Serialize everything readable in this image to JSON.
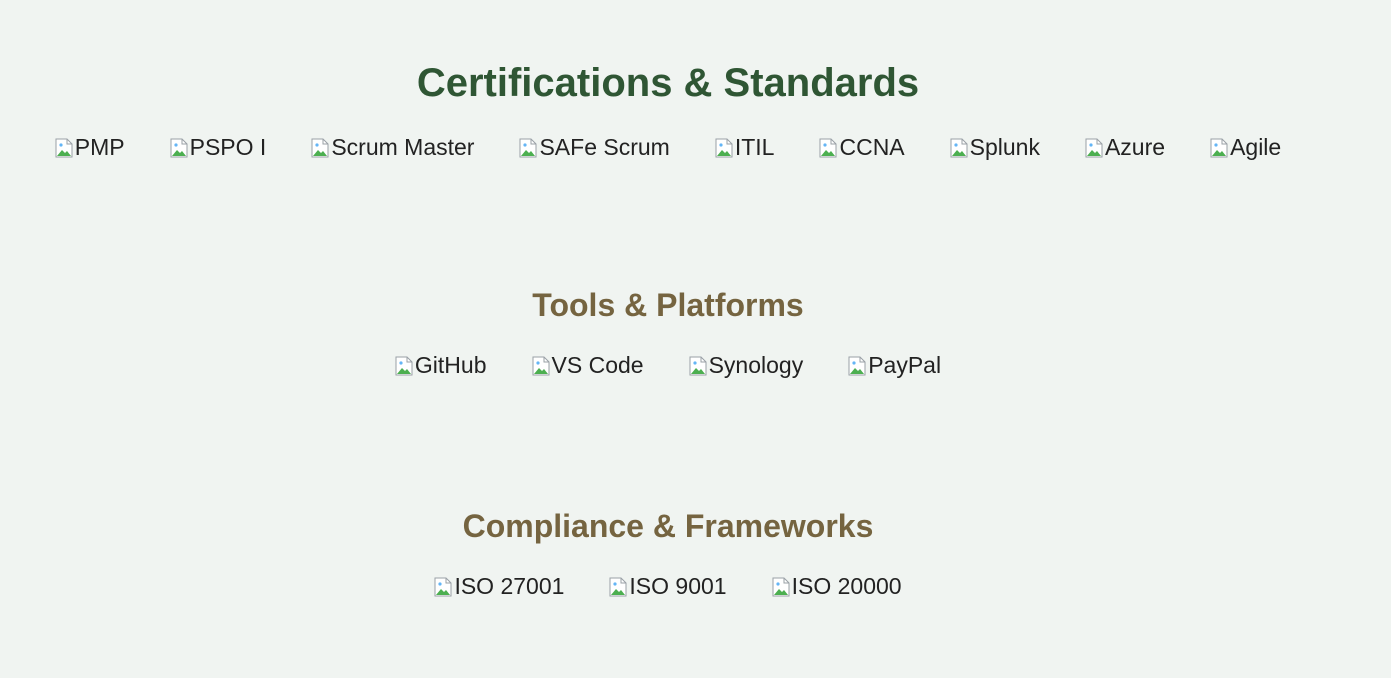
{
  "sections": [
    {
      "title": "Certifications & Standards",
      "items": [
        "PMP",
        "PSPO I",
        "Scrum Master",
        "SAFe Scrum",
        "ITIL",
        "CCNA",
        "Splunk",
        "Azure",
        "Agile"
      ]
    },
    {
      "title": "Tools & Platforms",
      "items": [
        "GitHub",
        "VS Code",
        "Synology",
        "PayPal"
      ]
    },
    {
      "title": "Compliance & Frameworks",
      "items": [
        "ISO 27001",
        "ISO 9001",
        "ISO 20000"
      ]
    }
  ],
  "colors": {
    "background": "#f0f4f1",
    "primary_heading": "#2f5634",
    "secondary_heading": "#756440",
    "text": "#222222"
  },
  "icons": {
    "broken_image": "broken-image-icon"
  }
}
